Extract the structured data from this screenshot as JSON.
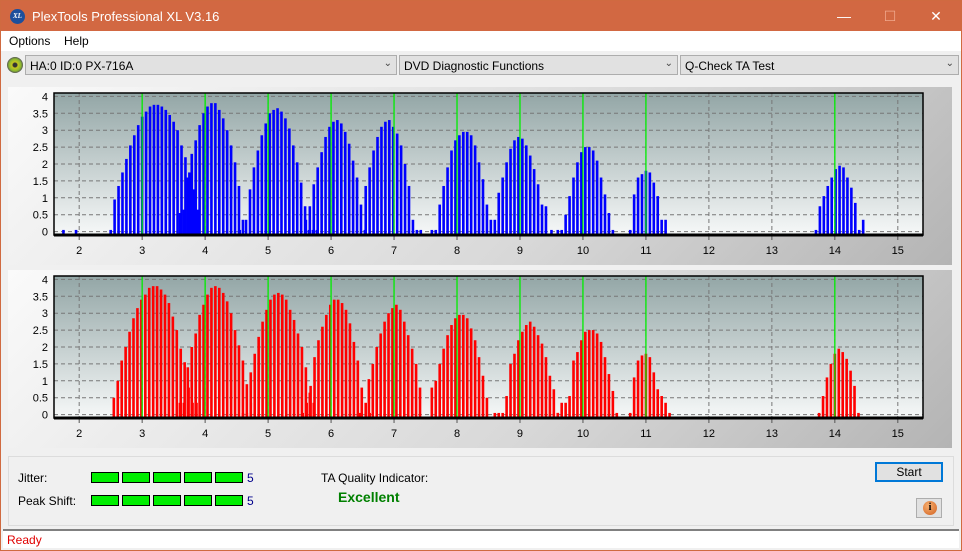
{
  "window": {
    "title": "PlexTools Professional XL V3.16",
    "logo_text": "XL"
  },
  "menu": [
    "Options",
    "Help"
  ],
  "toolbar": {
    "drive": "HA:0 ID:0  PX-716A",
    "function": "DVD Diagnostic Functions",
    "test": "Q-Check TA Test"
  },
  "results": {
    "jitter_label": "Jitter:",
    "jitter_value": "5",
    "jitter_segments": 5,
    "peak_label": "Peak Shift:",
    "peak_value": "5",
    "peak_segments": 5,
    "ta_label": "TA Quality Indicator:",
    "ta_value": "Excellent",
    "start_label": "Start",
    "info_glyph": "i"
  },
  "status": "Ready",
  "colors": {
    "top_bars": "#0000ff",
    "bottom_bars": "#ff0000",
    "marker": "#00ee00",
    "excellent": "#008000",
    "status_text": "#e00000"
  },
  "chart_data": [
    {
      "type": "bar",
      "name": "top-histogram",
      "xlim": [
        1.6,
        15.4
      ],
      "ylim": [
        -0.1,
        4.1
      ],
      "xticks": [
        2,
        3,
        4,
        5,
        6,
        7,
        8,
        9,
        10,
        11,
        12,
        13,
        14,
        15
      ],
      "yticks": [
        0,
        0.5,
        1,
        1.5,
        2,
        2.5,
        3,
        3.5,
        4
      ],
      "ytick_labels": [
        "0",
        "0.5",
        "1",
        "1.5",
        "2",
        "2.5",
        "3",
        "3.5",
        "4"
      ],
      "markers": [
        3,
        4,
        5,
        6,
        7,
        8,
        9,
        10,
        11,
        14
      ],
      "bar_color": "#0000ff",
      "clusters": [
        {
          "start": 1.75,
          "values": [
            0.05
          ]
        },
        {
          "start": 1.95,
          "values": [
            0.05
          ]
        },
        {
          "start": 2.5,
          "values": [
            0.05,
            0.95,
            1.35,
            1.75,
            2.15,
            2.55,
            2.85,
            3.15,
            3.4,
            3.55,
            3.7,
            3.75,
            3.75,
            3.7,
            3.6,
            3.45,
            3.25,
            3.0,
            2.55,
            2.2,
            1.75,
            1.25,
            0.65
          ]
        },
        {
          "start": 3.6,
          "values": [
            0.55,
            0.65,
            1.6,
            2.3,
            2.7,
            3.15,
            3.5,
            3.7,
            3.8,
            3.8,
            3.6,
            3.35,
            3.0,
            2.55,
            2.05,
            1.35,
            0.35
          ]
        },
        {
          "start": 4.55,
          "values": [
            0.05
          ]
        },
        {
          "start": 4.65,
          "values": [
            0.35,
            1.25,
            1.9,
            2.4,
            2.85,
            3.2,
            3.5,
            3.6,
            3.65,
            3.55,
            3.35,
            3.05,
            2.55,
            2.05,
            1.45,
            0.75,
            0.05,
            0.05,
            0.05
          ]
        },
        {
          "start": 5.6,
          "values": [
            0.35,
            0.75,
            1.4,
            1.9,
            2.35,
            2.8,
            3.1,
            3.25,
            3.3,
            3.2,
            2.95,
            2.6,
            2.1,
            1.6,
            0.8,
            0.05
          ]
        },
        {
          "start": 6.55,
          "values": [
            1.35,
            1.9,
            2.4,
            2.8,
            3.1,
            3.25,
            3.3,
            3.1,
            2.9,
            2.55,
            2.0,
            1.35,
            0.35,
            0.05,
            0.05
          ]
        },
        {
          "start": 7.6,
          "values": [
            0.05,
            0.05,
            0.8,
            1.35,
            1.9,
            2.4,
            2.7,
            2.85,
            2.95,
            2.95,
            2.85,
            2.55,
            2.05,
            1.55,
            0.8,
            0.35,
            0.05
          ]
        },
        {
          "start": 8.6,
          "values": [
            0.35,
            1.15,
            1.6,
            2.05,
            2.45,
            2.7,
            2.8,
            2.75,
            2.55,
            2.25,
            1.85,
            1.4,
            0.8,
            0.75
          ]
        },
        {
          "start": 9.5,
          "values": [
            0.05
          ]
        },
        {
          "start": 9.6,
          "values": [
            0.05,
            0.05,
            0.5,
            1.05,
            1.6,
            2.05,
            2.35,
            2.5,
            2.5,
            2.4,
            2.1,
            1.6,
            1.1,
            0.55,
            0.05
          ]
        },
        {
          "start": 10.75,
          "values": [
            0.05,
            1.1,
            1.6,
            1.7,
            1.8,
            1.75,
            1.45,
            1.05,
            0.35,
            0.35
          ]
        },
        {
          "start": 13.7,
          "values": [
            0.05,
            0.75,
            1.05,
            1.35,
            1.6,
            1.85,
            1.95,
            1.9,
            1.6,
            1.3,
            0.85,
            0.05,
            0.35
          ]
        }
      ]
    },
    {
      "type": "bar",
      "name": "bottom-histogram",
      "xlim": [
        1.6,
        15.4
      ],
      "ylim": [
        -0.1,
        4.1
      ],
      "xticks": [
        2,
        3,
        4,
        5,
        6,
        7,
        8,
        9,
        10,
        11,
        12,
        13,
        14,
        15
      ],
      "yticks": [
        0,
        0.5,
        1,
        1.5,
        2,
        2.5,
        3,
        3.5,
        4
      ],
      "ytick_labels": [
        "0",
        "0.5",
        "1",
        "1.5",
        "2",
        "2.5",
        "3",
        "3.5",
        "4"
      ],
      "markers": [
        3,
        4,
        5,
        6,
        7,
        8,
        9,
        10,
        11,
        14
      ],
      "bar_color": "#ff0000",
      "clusters": [
        {
          "start": 2.55,
          "values": [
            0.5,
            1.0,
            1.6,
            2.0,
            2.45,
            2.85,
            3.15,
            3.4,
            3.55,
            3.75,
            3.8,
            3.8,
            3.7,
            3.55,
            3.3,
            2.9,
            2.5,
            1.95,
            1.55,
            0.8,
            0.35,
            0.35
          ]
        },
        {
          "start": 3.6,
          "values": [
            0.35,
            0.35,
            1.4,
            2.0,
            2.4,
            2.95,
            3.25,
            3.55,
            3.75,
            3.8,
            3.75,
            3.6,
            3.35,
            3.0,
            2.5,
            2.05,
            1.6,
            0.9,
            0.35
          ]
        },
        {
          "start": 4.6,
          "values": [
            0.05,
            0.05,
            1.25,
            1.8,
            2.3,
            2.75,
            3.1,
            3.4,
            3.55,
            3.6,
            3.55,
            3.4,
            3.1,
            2.8,
            2.4,
            2.0,
            1.4,
            0.65,
            0.35
          ]
        },
        {
          "start": 5.55,
          "values": [
            0.05,
            0.35,
            0.85,
            1.7,
            2.2,
            2.6,
            2.95,
            3.25,
            3.4,
            3.4,
            3.3,
            3.1,
            2.7,
            2.15,
            1.6,
            0.8,
            0.35,
            0.05
          ]
        },
        {
          "start": 6.45,
          "values": [
            0.05
          ]
        },
        {
          "start": 6.6,
          "values": [
            1.05,
            1.5,
            2.0,
            2.4,
            2.75,
            3.0,
            3.15,
            3.25,
            3.1,
            2.75,
            2.35,
            1.95,
            1.5,
            0.8
          ]
        },
        {
          "start": 7.6,
          "values": [
            0.8,
            1.0,
            1.5,
            1.95,
            2.35,
            2.65,
            2.85,
            2.95,
            2.95,
            2.85,
            2.55,
            2.2,
            1.7,
            1.15,
            0.5
          ]
        },
        {
          "start": 8.6,
          "values": [
            0.05,
            0.05,
            0.05,
            0.55,
            1.5,
            1.8,
            2.2,
            2.45,
            2.65,
            2.75,
            2.6,
            2.35,
            2.1,
            1.7,
            1.15,
            0.75,
            0.05
          ]
        },
        {
          "start": 9.6,
          "values": [
            0.05,
            0.35,
            0.35,
            0.55,
            1.6,
            1.85,
            2.2,
            2.45,
            2.5,
            2.5,
            2.4,
            2.15,
            1.7,
            1.2,
            0.7,
            0.05
          ]
        },
        {
          "start": 10.75,
          "values": [
            0.05,
            1.1,
            1.6,
            1.75,
            1.8,
            1.7,
            1.25,
            0.75,
            0.55,
            0.35,
            0.05
          ]
        },
        {
          "start": 13.75,
          "values": [
            0.05,
            0.55,
            1.1,
            1.5,
            1.8,
            1.95,
            1.85,
            1.65,
            1.3,
            0.85,
            0.05
          ]
        }
      ]
    }
  ]
}
